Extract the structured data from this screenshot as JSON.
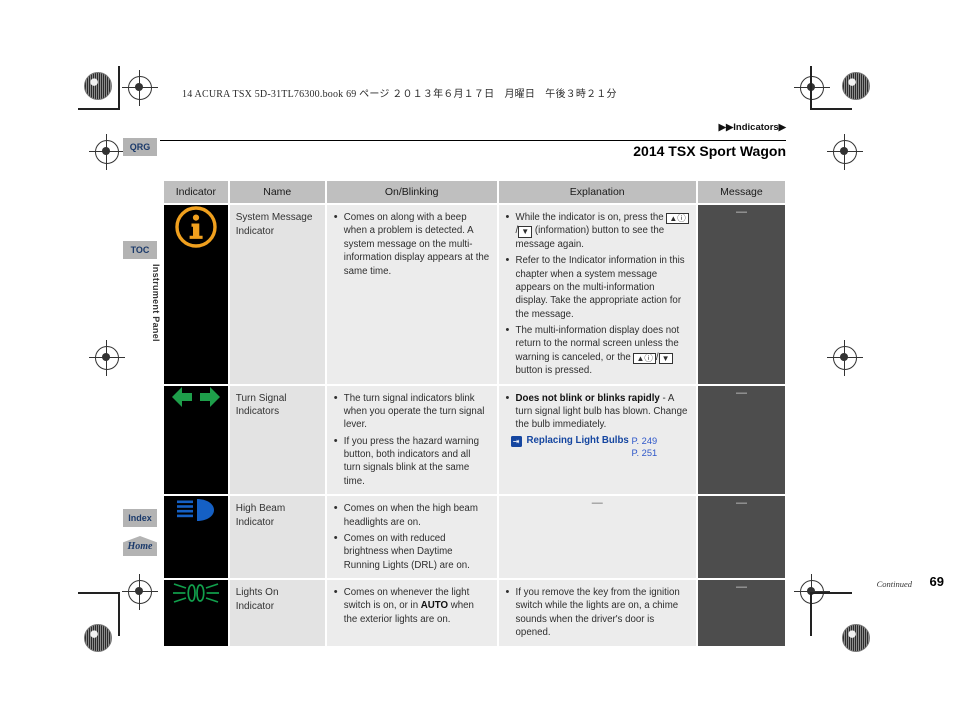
{
  "print_header": "14 ACURA TSX 5D-31TL76300.book  69 ページ  ２０１３年６月１７日　月曜日　午後３時２１分",
  "breadcrumb": "▶▶Indicators▶",
  "doc_title": "2014 TSX Sport Wagon",
  "side_tabs": [
    {
      "label": "QRG",
      "name": "qrg"
    },
    {
      "label": "TOC",
      "name": "toc"
    },
    {
      "label": "Index",
      "name": "index"
    },
    {
      "label": "Home",
      "name": "home"
    }
  ],
  "chapter_label": "Instrument Panel",
  "table": {
    "columns": [
      "Indicator",
      "Name",
      "On/Blinking",
      "Explanation",
      "Message"
    ],
    "rows": [
      {
        "icon": "system-message-info-icon",
        "name": "System Message\nIndicator",
        "on_blinking": [
          "Comes on along with a beep when a problem is detected. A system message on the multi-information display appears at the same time."
        ],
        "explanation": [
          "While the indicator is on, press the [▲ⓘ]/[▼] (information) button to see the message again.",
          "Refer to the Indicator information in this chapter when a system message appears on the multi-information display. Take the appropriate action for the message.",
          "The multi-information display does not return to the normal screen unless the warning is canceled, or the [▲ⓘ]/[▼] button is pressed."
        ],
        "message": "—"
      },
      {
        "icon": "turn-signal-arrows-icon",
        "name": "Turn Signal\nIndicators",
        "on_blinking": [
          "The turn signal indicators blink when you operate the turn signal lever.",
          "If you press the hazard warning button, both indicators and all turn signals blink at the same time."
        ],
        "explanation": [
          "Does not blink or blinks rapidly - A turn signal light bulb has blown. Change the bulb immediately."
        ],
        "explanation_bold_lead": "Does not blink or blinks rapidly",
        "explanation_rest": " - A turn signal light bulb has blown. Change the bulb immediately.",
        "reference": {
          "title": "Replacing Light Bulbs",
          "pages": [
            "P. 249",
            "P. 251"
          ]
        },
        "message": "—"
      },
      {
        "icon": "high-beam-headlight-icon",
        "name": "High Beam\nIndicator",
        "on_blinking": [
          "Comes on when the high beam headlights are on.",
          "Comes on with reduced brightness when Daytime Running Lights (DRL) are on."
        ],
        "explanation_dash": "—",
        "message": "—"
      },
      {
        "icon": "lights-on-indicator-icon",
        "name": "Lights On Indicator",
        "on_blinking_html_lead": "Comes on whenever the light switch is on, or in ",
        "on_blinking_bold": "AUTO",
        "on_blinking_html_tail": " when the exterior lights are on.",
        "explanation": [
          "If you remove the key from the ignition switch while the lights are on, a chime sounds when the driver's door is opened."
        ],
        "message": "—"
      }
    ]
  },
  "footer": {
    "continued": "Continued",
    "page_number": "69"
  },
  "colors": {
    "info_amber": "#F0A01E",
    "turn_green": "#1E9E4A",
    "high_beam_blue": "#1560C4",
    "lights_green": "#11A04C",
    "link_blue": "#1546a0",
    "header_gray": "#bfbfbf",
    "cell_gray": "#ececec",
    "message_gray": "#4d4d4d"
  }
}
